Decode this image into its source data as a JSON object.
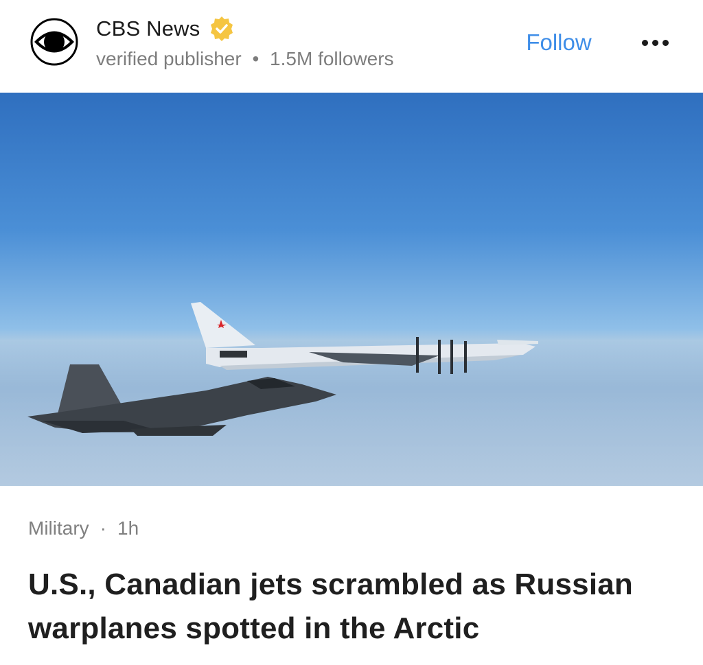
{
  "publisher": {
    "name": "CBS News",
    "meta": "verified publisher",
    "separator": "•",
    "followers": "1.5M followers",
    "logo_icon": "cbs-eye-logo",
    "badge_icon": "verified-check-badge",
    "badge_color": "#f5c542"
  },
  "actions": {
    "follow_label": "Follow",
    "follow_color": "#3f8ee8",
    "more_icon": "more-horizontal-icon"
  },
  "hero_image": {
    "subject": "military-jets-over-clouds"
  },
  "article": {
    "category": "Military",
    "separator": "·",
    "age": "1h",
    "headline": "U.S., Canadian jets scrambled as Russian warplanes spotted in the Arctic"
  }
}
